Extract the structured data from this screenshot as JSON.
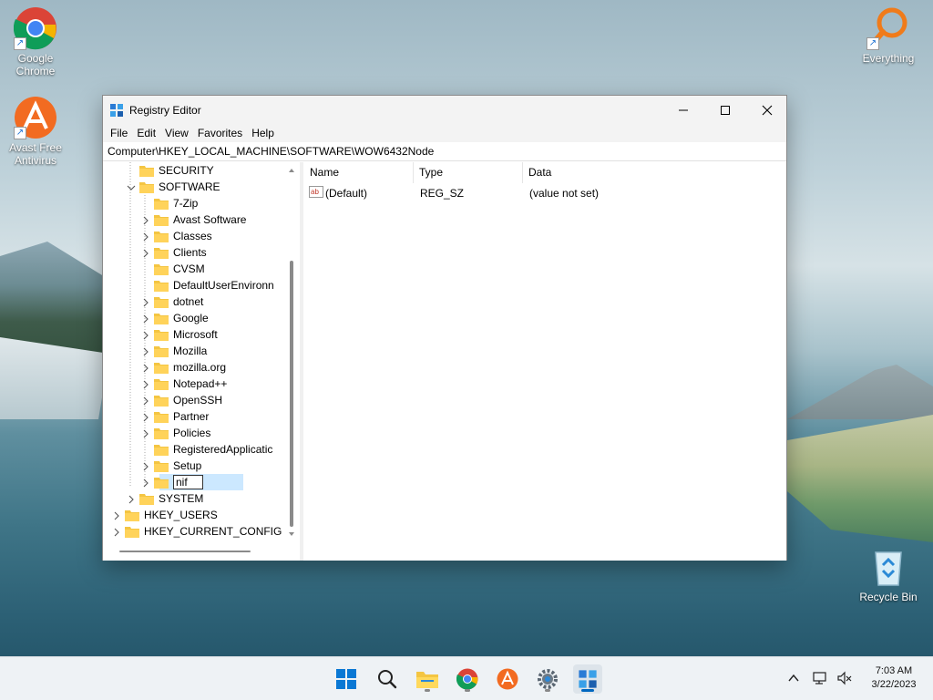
{
  "desktop": {
    "icons": [
      {
        "label": "Google Chrome"
      },
      {
        "label": "Avast Free Antivirus"
      },
      {
        "label": "Everything"
      },
      {
        "label": "Recycle Bin"
      }
    ]
  },
  "window": {
    "title": "Registry Editor",
    "menu": [
      "File",
      "Edit",
      "View",
      "Favorites",
      "Help"
    ],
    "address": "Computer\\HKEY_LOCAL_MACHINE\\SOFTWARE\\WOW6432Node",
    "tree": [
      {
        "label": "SECURITY",
        "expander": "none"
      },
      {
        "label": "SOFTWARE",
        "expander": "expanded"
      },
      {
        "label": "7-Zip",
        "expander": "none"
      },
      {
        "label": "Avast Software",
        "expander": "collapsed"
      },
      {
        "label": "Classes",
        "expander": "collapsed"
      },
      {
        "label": "Clients",
        "expander": "collapsed"
      },
      {
        "label": "CVSM",
        "expander": "none"
      },
      {
        "label": "DefaultUserEnvironn",
        "expander": "none"
      },
      {
        "label": "dotnet",
        "expander": "collapsed"
      },
      {
        "label": "Google",
        "expander": "collapsed"
      },
      {
        "label": "Microsoft",
        "expander": "collapsed"
      },
      {
        "label": "Mozilla",
        "expander": "collapsed"
      },
      {
        "label": "mozilla.org",
        "expander": "collapsed"
      },
      {
        "label": "Notepad++",
        "expander": "collapsed"
      },
      {
        "label": "OpenSSH",
        "expander": "collapsed"
      },
      {
        "label": "Partner",
        "expander": "collapsed"
      },
      {
        "label": "Policies",
        "expander": "collapsed"
      },
      {
        "label": "RegisteredApplicatic",
        "expander": "none"
      },
      {
        "label": "Setup",
        "expander": "collapsed"
      },
      {
        "label": "nif",
        "expander": "collapsed",
        "editing": true
      },
      {
        "label": "SYSTEM",
        "expander": "collapsed"
      },
      {
        "label": "HKEY_USERS",
        "expander": "collapsed"
      },
      {
        "label": "HKEY_CURRENT_CONFIG",
        "expander": "collapsed"
      }
    ],
    "list": {
      "columns": [
        "Name",
        "Type",
        "Data"
      ],
      "rows": [
        {
          "name": "(Default)",
          "type": "REG_SZ",
          "data": "(value not set)",
          "icon": "string-value-icon"
        }
      ]
    }
  },
  "taskbar": {
    "apps": [
      "windows-start-icon",
      "search-icon",
      "file-explorer-icon",
      "chrome-icon",
      "avast-icon",
      "settings-icon",
      "registry-editor-icon"
    ],
    "time": "7:03 AM",
    "date": "3/22/2023"
  },
  "colors": {
    "accent": "#0067c0",
    "folder": "#f4c542",
    "selection": "#cce8ff"
  }
}
